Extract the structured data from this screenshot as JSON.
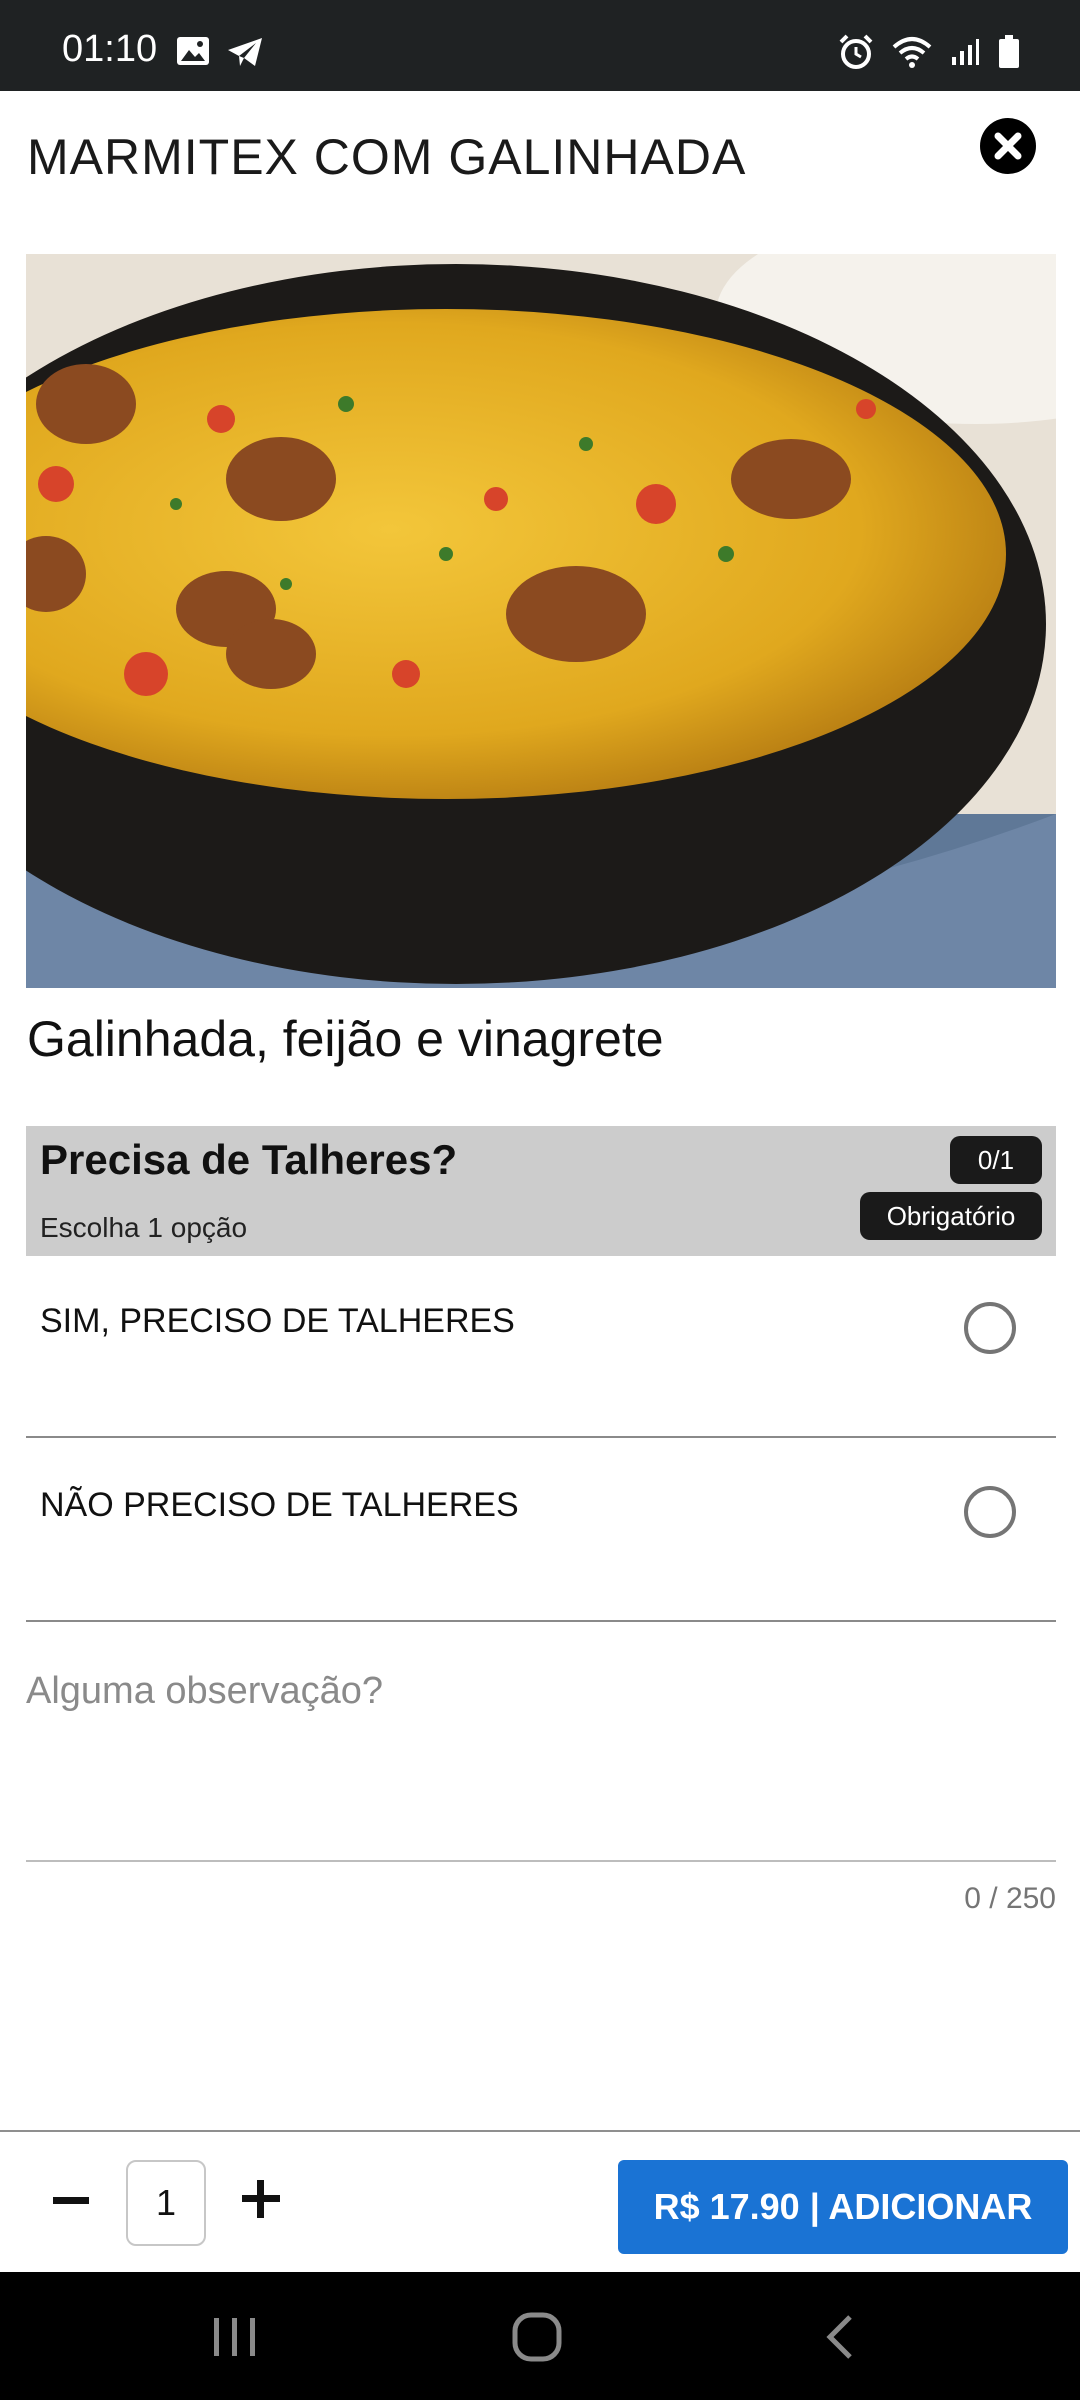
{
  "status_bar": {
    "time": "01:10",
    "left_icons": [
      "image-icon",
      "telegram-icon"
    ],
    "right_icons": [
      "alarm-icon",
      "wifi-icon",
      "signal-icon",
      "battery-icon"
    ]
  },
  "modal": {
    "title": "MARMITEX COM GALINHADA",
    "close_icon": "close-icon",
    "image_alt": "galinhada-photo",
    "description": "Galinhada, feijão e vinagrete"
  },
  "option_group": {
    "title": "Precisa de Talheres?",
    "subtitle": "Escolha 1 opção",
    "count_badge": "0/1",
    "required_badge": "Obrigatório",
    "options": [
      {
        "label": "SIM, PRECISO DE TALHERES",
        "selected": false
      },
      {
        "label": "NÃO PRECISO DE TALHERES",
        "selected": false
      }
    ]
  },
  "observation": {
    "placeholder": "Alguma observação?",
    "value": "",
    "counter": "0 / 250"
  },
  "bottom_bar": {
    "quantity": "1",
    "add_button_label": "R$ 17.90 | ADICIONAR",
    "accent_color": "#1a73d4"
  },
  "nav_bar": {
    "icons": [
      "recent-apps-icon",
      "home-icon",
      "back-icon"
    ]
  }
}
